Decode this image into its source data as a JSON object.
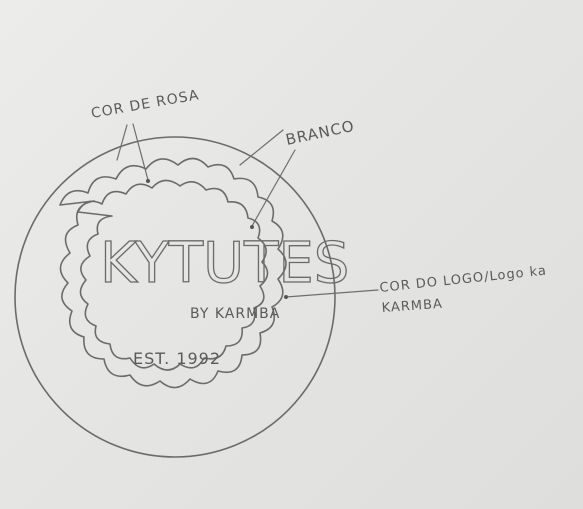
{
  "logo": {
    "brand": "KYTUTES",
    "byline": "BY KARMBA",
    "established": "EST. 1992"
  },
  "annotations": {
    "pink_color": "COR DE ROSA",
    "white": "BRANCO",
    "logo_color_line1": "COR DO LOGO/Logo ka",
    "logo_color_line2": "KARMBA"
  },
  "colors": {
    "paper": "#e8e8e6",
    "pencil": "#6b6b6b"
  }
}
